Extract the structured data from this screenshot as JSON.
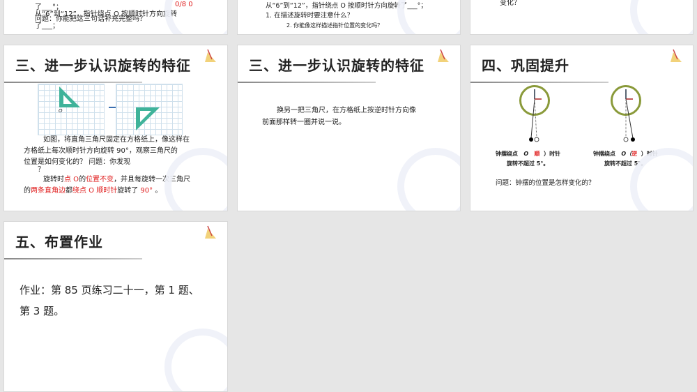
{
  "slides": [
    {
      "lines": [
        "了___°；",
        "从“6”到“12”，指针绕点 O 按顺时针方向旋转",
        "问题：你能把这三句话补充完整吗？",
        "了___；"
      ],
      "red": "0/8 0"
    },
    {
      "lines": [
        "从“6”到“12”，指针绕点 O 按顺时针方向旋转了___°；",
        "1. 在描述旋转时要注意什么？",
        "2. 你能像这样描述指针位置的变化吗？"
      ]
    },
    {
      "lines": [
        "变化？"
      ]
    },
    {
      "title": "三、进一步认识旋转的特征",
      "point_label": "O",
      "p1": "如图，将直角三角尺固定在方格纸上，像这样在",
      "p2": "方格纸上每次顺时针方向旋转 90°，观察三角尺的",
      "p3": "位置是如何变化的？ 问题：你发现",
      "p4": "？",
      "a1_pre": "旋转时",
      "a1_red1": "点 O",
      "a1_mid": "的",
      "a1_red2": "位置不变",
      "a1_post": "，并且每旋转一次三角尺",
      "a2_pre": "的",
      "a2_red1": "两条直角边",
      "a2_mid": "都",
      "a2_red2": "绕点 O 顺时针",
      "a2_post": "旋转了",
      "a2_val": "90°",
      "a2_end": "。"
    },
    {
      "title": "三、进一步认识旋转的特征",
      "p1": "换另一把三角尺，在方格纸上按逆时针方向像",
      "p2": "前面那样转一圈并说一说。"
    },
    {
      "title": "四、巩固提升",
      "c1a": "钟摆绕点",
      "c1o": "O",
      "c1dir": "顺",
      "c1b": "）时针",
      "c2a": "钟摆绕点",
      "c2o": "O（",
      "c2dir": "逆",
      "c2b": "）时针",
      "limit": "旋转不超过 5°。",
      "question": "问题：钟摆的位置是怎样变化的？"
    },
    {
      "title": "五、布置作业",
      "hw1": "作业：第 85 页练习二十一，第 1 题、",
      "hw2": "第 3 题。"
    }
  ],
  "colors": {
    "accent": "#e02020",
    "triangle": "#3fb39a"
  }
}
